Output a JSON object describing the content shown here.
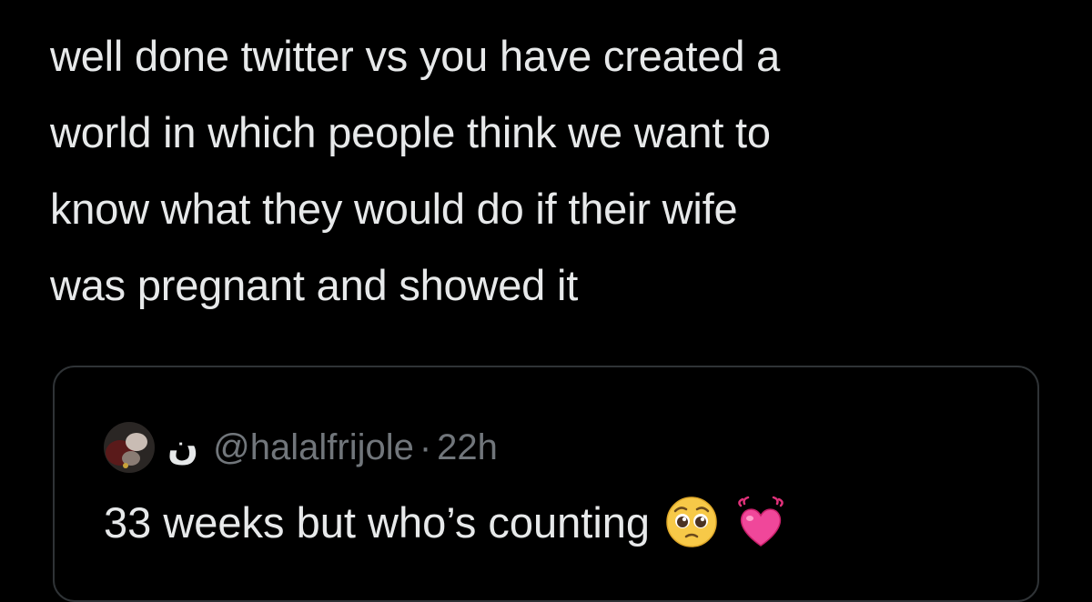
{
  "tweet": {
    "lines": [
      "well done twitter vs you have created a",
      "world in which people think we want to",
      "know what they would do if their wife",
      "was pregnant and showed it"
    ]
  },
  "quoted_tweet": {
    "display_name": "ن",
    "handle": "@halalfrijole",
    "separator": "·",
    "time": "22h",
    "text": "33 weeks but who’s counting",
    "emojis": [
      "pleading-face-emoji",
      "growing-heart-emoji"
    ]
  },
  "colors": {
    "background": "#000000",
    "text": "#e7e9ea",
    "muted": "#71767b",
    "border": "#2f3336"
  }
}
